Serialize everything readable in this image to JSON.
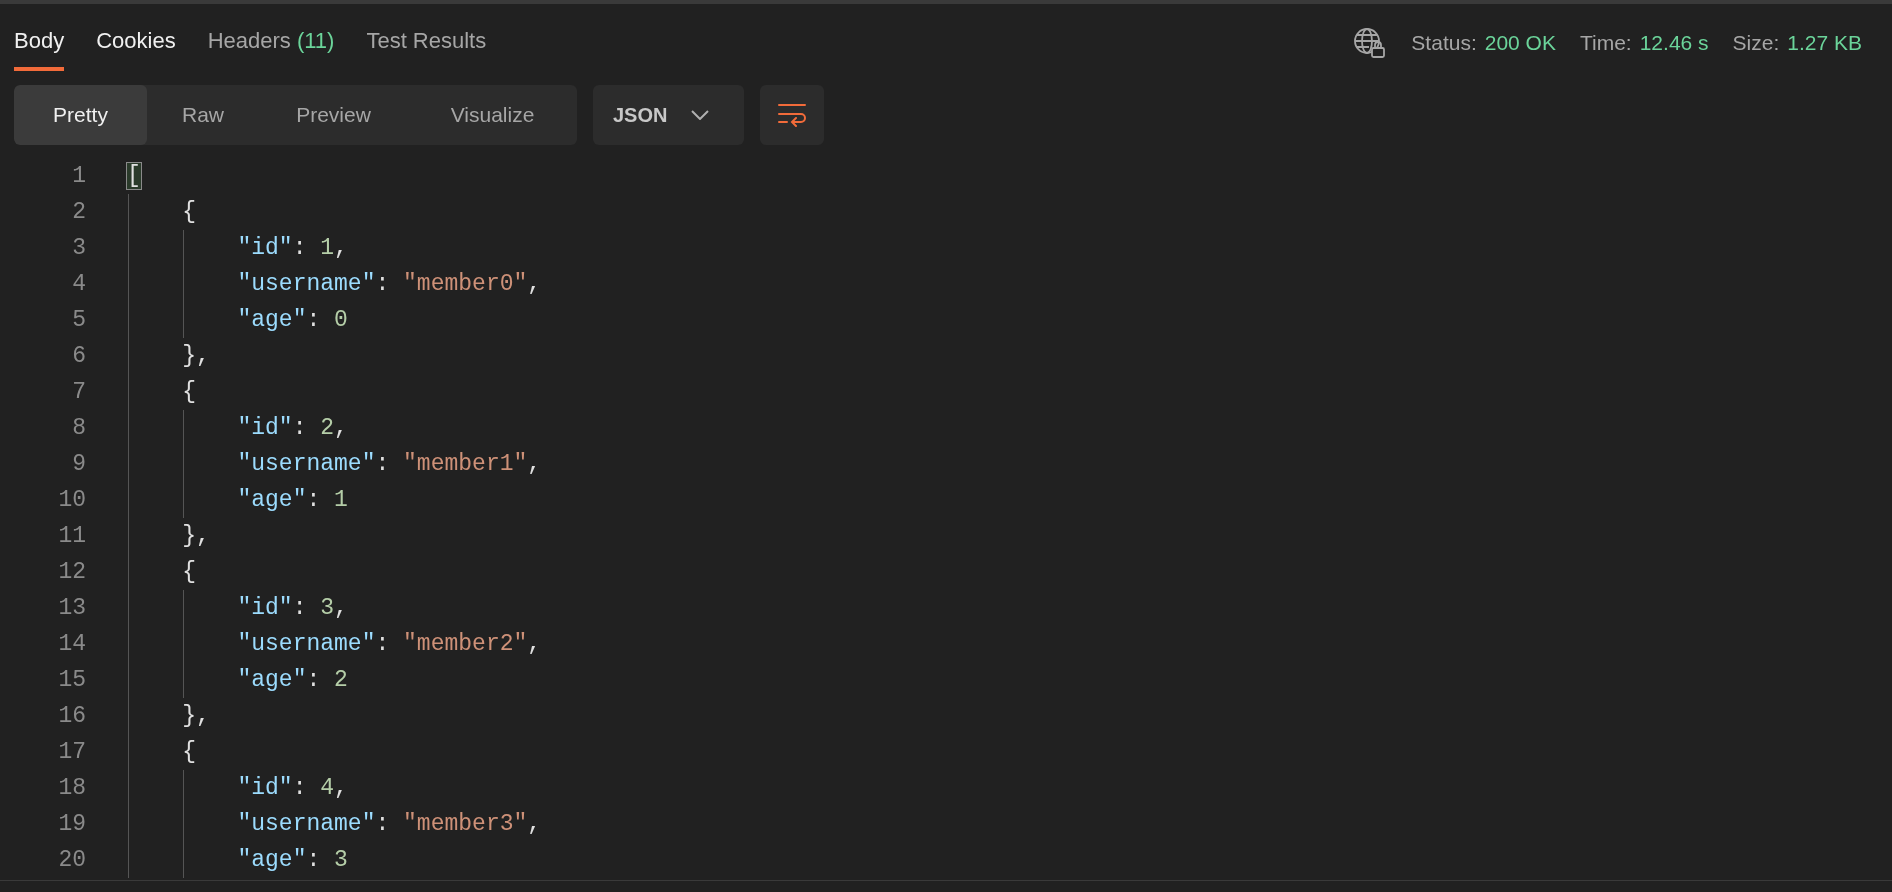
{
  "response_tabs": [
    {
      "label": "Body",
      "selected": true
    },
    {
      "label": "Cookies",
      "selected": false,
      "hovered": true
    },
    {
      "label": "Headers",
      "count": "(11)",
      "selected": false
    },
    {
      "label": "Test Results",
      "selected": false
    }
  ],
  "response_meta": [
    {
      "label": "Status:",
      "value": "200 OK"
    },
    {
      "label": "Time:",
      "value": "12.46 s"
    },
    {
      "label": "Size:",
      "value": "1.27 KB"
    }
  ],
  "view_modes": [
    {
      "label": "Pretty",
      "selected": true
    },
    {
      "label": "Raw",
      "selected": false
    },
    {
      "label": "Preview",
      "selected": false
    },
    {
      "label": "Visualize",
      "selected": false
    }
  ],
  "format_dropdown": {
    "value": "JSON"
  },
  "code_lines": [
    {
      "number": "1",
      "matched_bracket": true,
      "tokens": [
        {
          "kind": "punct",
          "text": "["
        }
      ]
    },
    {
      "number": "2",
      "matched_bracket": false,
      "tokens": [
        {
          "kind": "punct",
          "text": "    {"
        }
      ]
    },
    {
      "number": "3",
      "matched_bracket": false,
      "tokens": [
        {
          "kind": "key",
          "text": "        \"id\""
        },
        {
          "kind": "punct",
          "text": ": "
        },
        {
          "kind": "number",
          "text": "1"
        },
        {
          "kind": "punct",
          "text": ","
        }
      ]
    },
    {
      "number": "4",
      "matched_bracket": false,
      "tokens": [
        {
          "kind": "key",
          "text": "        \"username\""
        },
        {
          "kind": "punct",
          "text": ": "
        },
        {
          "kind": "string",
          "text": "\"member0\""
        },
        {
          "kind": "punct",
          "text": ","
        }
      ]
    },
    {
      "number": "5",
      "matched_bracket": false,
      "tokens": [
        {
          "kind": "key",
          "text": "        \"age\""
        },
        {
          "kind": "punct",
          "text": ": "
        },
        {
          "kind": "number",
          "text": "0"
        }
      ]
    },
    {
      "number": "6",
      "matched_bracket": false,
      "tokens": [
        {
          "kind": "punct",
          "text": "    },"
        }
      ]
    },
    {
      "number": "7",
      "matched_bracket": false,
      "tokens": [
        {
          "kind": "punct",
          "text": "    {"
        }
      ]
    },
    {
      "number": "8",
      "matched_bracket": false,
      "tokens": [
        {
          "kind": "key",
          "text": "        \"id\""
        },
        {
          "kind": "punct",
          "text": ": "
        },
        {
          "kind": "number",
          "text": "2"
        },
        {
          "kind": "punct",
          "text": ","
        }
      ]
    },
    {
      "number": "9",
      "matched_bracket": false,
      "tokens": [
        {
          "kind": "key",
          "text": "        \"username\""
        },
        {
          "kind": "punct",
          "text": ": "
        },
        {
          "kind": "string",
          "text": "\"member1\""
        },
        {
          "kind": "punct",
          "text": ","
        }
      ]
    },
    {
      "number": "10",
      "matched_bracket": false,
      "tokens": [
        {
          "kind": "key",
          "text": "        \"age\""
        },
        {
          "kind": "punct",
          "text": ": "
        },
        {
          "kind": "number",
          "text": "1"
        }
      ]
    },
    {
      "number": "11",
      "matched_bracket": false,
      "tokens": [
        {
          "kind": "punct",
          "text": "    },"
        }
      ]
    },
    {
      "number": "12",
      "matched_bracket": false,
      "tokens": [
        {
          "kind": "punct",
          "text": "    {"
        }
      ]
    },
    {
      "number": "13",
      "matched_bracket": false,
      "tokens": [
        {
          "kind": "key",
          "text": "        \"id\""
        },
        {
          "kind": "punct",
          "text": ": "
        },
        {
          "kind": "number",
          "text": "3"
        },
        {
          "kind": "punct",
          "text": ","
        }
      ]
    },
    {
      "number": "14",
      "matched_bracket": false,
      "tokens": [
        {
          "kind": "key",
          "text": "        \"username\""
        },
        {
          "kind": "punct",
          "text": ": "
        },
        {
          "kind": "string",
          "text": "\"member2\""
        },
        {
          "kind": "punct",
          "text": ","
        }
      ]
    },
    {
      "number": "15",
      "matched_bracket": false,
      "tokens": [
        {
          "kind": "key",
          "text": "        \"age\""
        },
        {
          "kind": "punct",
          "text": ": "
        },
        {
          "kind": "number",
          "text": "2"
        }
      ]
    },
    {
      "number": "16",
      "matched_bracket": false,
      "tokens": [
        {
          "kind": "punct",
          "text": "    },"
        }
      ]
    },
    {
      "number": "17",
      "matched_bracket": false,
      "tokens": [
        {
          "kind": "punct",
          "text": "    {"
        }
      ]
    },
    {
      "number": "18",
      "matched_bracket": false,
      "tokens": [
        {
          "kind": "key",
          "text": "        \"id\""
        },
        {
          "kind": "punct",
          "text": ": "
        },
        {
          "kind": "number",
          "text": "4"
        },
        {
          "kind": "punct",
          "text": ","
        }
      ]
    },
    {
      "number": "19",
      "matched_bracket": false,
      "tokens": [
        {
          "kind": "key",
          "text": "        \"username\""
        },
        {
          "kind": "punct",
          "text": ": "
        },
        {
          "kind": "string",
          "text": "\"member3\""
        },
        {
          "kind": "punct",
          "text": ","
        }
      ]
    },
    {
      "number": "20",
      "matched_bracket": false,
      "tokens": [
        {
          "kind": "key",
          "text": "        \"age\""
        },
        {
          "kind": "punct",
          "text": ": "
        },
        {
          "kind": "number",
          "text": "3"
        }
      ]
    }
  ]
}
